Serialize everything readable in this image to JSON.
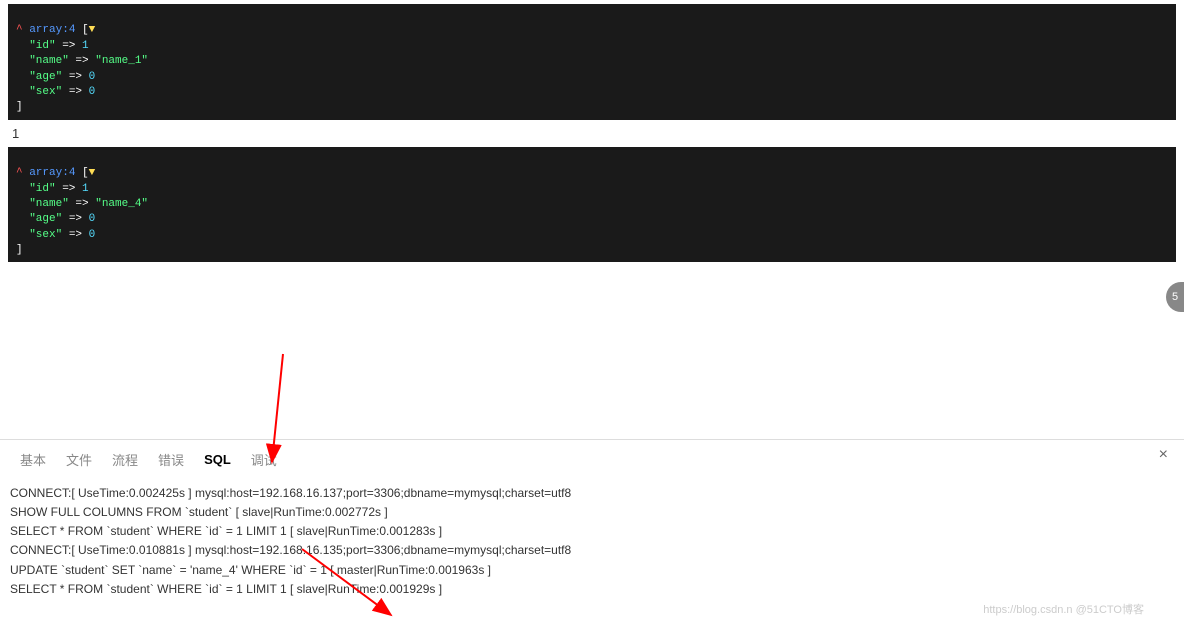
{
  "block1": {
    "line1_caret": "^",
    "line1_array": " array:4",
    "line1_bracket": " [",
    "line1_arrow": "▼",
    "line2_key": "  \"id\"",
    "line2_arrow": " => ",
    "line2_val": "1",
    "line3_key": "  \"name\"",
    "line3_arrow": " => ",
    "line3_val": "\"name_1\"",
    "line4_key": "  \"age\"",
    "line4_arrow": " => ",
    "line4_val": "0",
    "line5_key": "  \"sex\"",
    "line5_arrow": " => ",
    "line5_val": "0",
    "line6": "]"
  },
  "between": "1",
  "block2": {
    "line1_caret": "^",
    "line1_array": " array:4",
    "line1_bracket": " [",
    "line1_arrow": "▼",
    "line2_key": "  \"id\"",
    "line2_arrow": " => ",
    "line2_val": "1",
    "line3_key": "  \"name\"",
    "line3_arrow": " => ",
    "line3_val": "\"name_4\"",
    "line4_key": "  \"age\"",
    "line4_arrow": " => ",
    "line4_val": "0",
    "line5_key": "  \"sex\"",
    "line5_arrow": " => ",
    "line5_val": "0",
    "line6": "]"
  },
  "tabs": {
    "basic": "基本",
    "file": "文件",
    "flow": "流程",
    "error": "错误",
    "sql": "SQL",
    "debug": "调试"
  },
  "sql_lines": [
    "CONNECT:[ UseTime:0.002425s ] mysql:host=192.168.16.137;port=3306;dbname=mymysql;charset=utf8",
    "SHOW FULL COLUMNS FROM `student` [ slave|RunTime:0.002772s ]",
    "SELECT * FROM `student` WHERE `id` = 1 LIMIT 1 [ slave|RunTime:0.001283s ]",
    "CONNECT:[ UseTime:0.010881s ] mysql:host=192.168.16.135;port=3306;dbname=mymysql;charset=utf8",
    "UPDATE `student` SET `name` = 'name_4' WHERE `id` = 1 [ master|RunTime:0.001963s ]",
    "SELECT * FROM `student` WHERE `id` = 1 LIMIT 1 [ slave|RunTime:0.001929s ]"
  ],
  "watermark": "https://blog.csdn.n @51CTO博客",
  "badge": "5"
}
